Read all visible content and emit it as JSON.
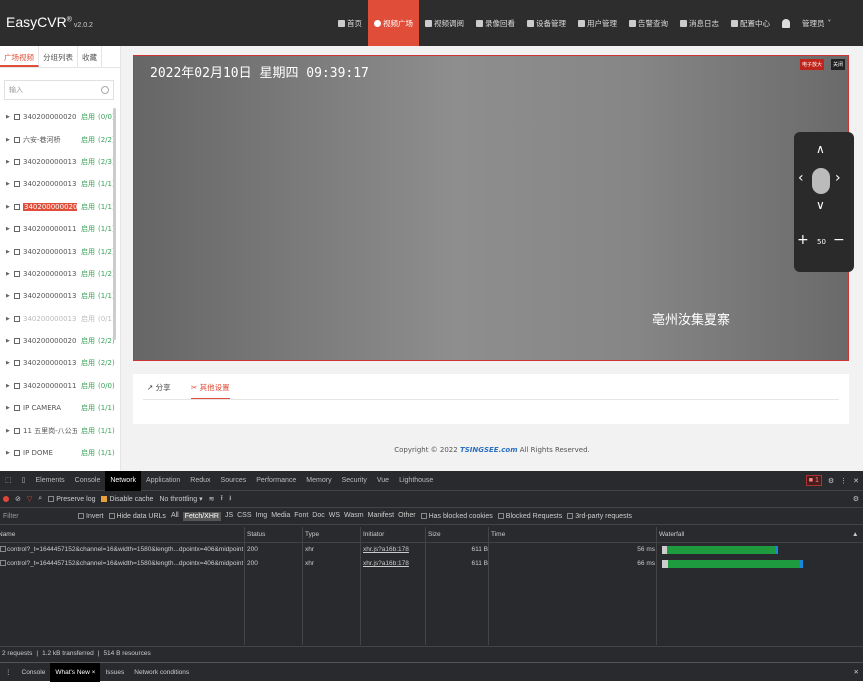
{
  "app": {
    "name": "EasyCVR",
    "reg": "®",
    "version": "v2.0.2"
  },
  "nav": [
    {
      "label": "首页",
      "active": false
    },
    {
      "label": "视频广场",
      "active": true
    },
    {
      "label": "视频调阅",
      "active": false
    },
    {
      "label": "录像回看",
      "active": false
    },
    {
      "label": "设备管理",
      "active": false
    },
    {
      "label": "用户管理",
      "active": false
    },
    {
      "label": "告警查询",
      "active": false
    },
    {
      "label": "消息日志",
      "active": false
    },
    {
      "label": "配置中心",
      "active": false
    }
  ],
  "user": {
    "label": "管理员",
    "caret": "˅"
  },
  "sidebar": {
    "tabs": [
      "广场视频",
      "分组列表",
      "收藏"
    ],
    "search_placeholder": "输入",
    "items": [
      {
        "name": "3402000000200...",
        "status": "启用",
        "count": "(0/0)"
      },
      {
        "name": "六安-巷河桥",
        "status": "启用",
        "count": "(2/2)"
      },
      {
        "name": "3402000000132...",
        "status": "启用",
        "count": "(2/3)"
      },
      {
        "name": "3402000000132...",
        "status": "启用",
        "count": "(1/1)"
      },
      {
        "name": "3402000000200...",
        "status": "启用",
        "count": "(1/1)"
      },
      {
        "name": "3402000000110...",
        "status": "启用",
        "count": "(1/1)"
      },
      {
        "name": "3402000000132...",
        "status": "启用",
        "count": "(1/2)"
      },
      {
        "name": "3402000000132...",
        "status": "启用",
        "count": "(1/2)"
      },
      {
        "name": "3402000000132...",
        "status": "启用",
        "count": "(1/1)"
      },
      {
        "name": "3402000000132...",
        "status": "启用",
        "count": "(0/1)"
      },
      {
        "name": "3402000000200...",
        "status": "启用",
        "count": "(2/2)"
      },
      {
        "name": "3402000000132...",
        "status": "启用",
        "count": "(2/2)"
      },
      {
        "name": "3402000000110...",
        "status": "启用",
        "count": "(0/0)"
      },
      {
        "name": "IP CAMERA",
        "status": "启用",
        "count": "(1/1)"
      },
      {
        "name": "11 五里岗-八公五...",
        "status": "启用",
        "count": "(1/1)"
      },
      {
        "name": "IP DOME",
        "status": "启用",
        "count": "(1/1)"
      }
    ]
  },
  "video": {
    "osd_time": "2022年02月10日 星期四 09:39:17",
    "osd_location": "亳州汝集夏寨",
    "btn_record": "电子放大",
    "btn_close": "关闭",
    "ptz_speed": "50"
  },
  "subtabs": {
    "share": "分享",
    "other": "其他设置"
  },
  "footer": {
    "prefix": "Copyright © 2022",
    "brand": "TSINGSEE.com",
    "suffix": "All Rights Reserved."
  },
  "devtools": {
    "tabs": [
      "Elements",
      "Console",
      "Network",
      "Application",
      "Redux",
      "Sources",
      "Performance",
      "Memory",
      "Security",
      "Vue",
      "Lighthouse"
    ],
    "error_count": "1",
    "toolbar": {
      "preserve_log": "Preserve log",
      "disable_cache": "Disable cache",
      "throttle": "No throttling"
    },
    "filter": {
      "placeholder": "Filter",
      "invert": "Invert",
      "hide_data": "Hide data URLs",
      "types": [
        "All",
        "Fetch/XHR",
        "JS",
        "CSS",
        "Img",
        "Media",
        "Font",
        "Doc",
        "WS",
        "Wasm",
        "Manifest",
        "Other"
      ],
      "blocked_cookies": "Has blocked cookies",
      "blocked_requests": "Blocked Requests",
      "third_party": "3rd-party requests"
    },
    "columns": [
      "Name",
      "Status",
      "Type",
      "Initiator",
      "Size",
      "Time",
      "Waterfall"
    ],
    "rows": [
      {
        "name": "control?_t=1644457152&channel=16&width=1580&length...dpointx=406&midpointy=140&leng...",
        "status": "200",
        "type": "xhr",
        "initiator": "xhr.js?a16b:178",
        "size": "611 B",
        "time": "56 ms"
      },
      {
        "name": "control?_t=1644457152&channel=16&width=1580&length...dpointx=406&midpointy=140&leng...",
        "status": "200",
        "type": "xhr",
        "initiator": "xhr.js?a16b:178",
        "size": "611 B",
        "time": "66 ms"
      }
    ],
    "summary": {
      "requests": "2 requests",
      "transferred": "1.2 kB transferred",
      "resources": "514 B resources"
    },
    "drawer_tabs": [
      "Console",
      "What's New",
      "Issues",
      "Network conditions"
    ]
  }
}
